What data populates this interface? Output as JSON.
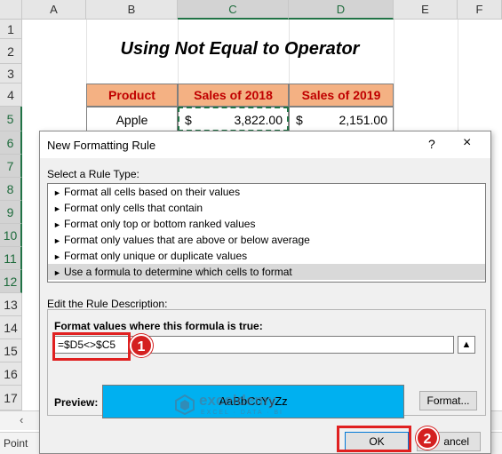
{
  "sheet": {
    "columns": [
      "A",
      "B",
      "C",
      "D",
      "E",
      "F"
    ],
    "rows": [
      "1",
      "2",
      "3",
      "4",
      "5",
      "6",
      "7",
      "8",
      "9",
      "10",
      "11",
      "12",
      "13",
      "14",
      "15",
      "16",
      "17"
    ],
    "title": "Using Not Equal to Operator",
    "headers": [
      "Product",
      "Sales of 2018",
      "Sales of 2019"
    ],
    "row5": {
      "product": "Apple",
      "cur1": "$",
      "sales2018": "3,822.00",
      "cur2": "$",
      "sales2019": "2,151.00"
    },
    "status": "Point",
    "colors": {
      "header_fill": "#f4b183",
      "header_text": "#c00000",
      "selection": "#217346"
    }
  },
  "dialog": {
    "title": "New Formatting Rule",
    "help": "?",
    "close": "×",
    "select_rule_label": "Select a Rule Type:",
    "rule_types": [
      "Format all cells based on their values",
      "Format only cells that contain",
      "Format only top or bottom ranked values",
      "Format only values that are above or below average",
      "Format only unique or duplicate values",
      "Use a formula to determine which cells to format"
    ],
    "selected_rule_index": 5,
    "edit_label": "Edit the Rule Description:",
    "format_values_label": "Format values where this formula is true:",
    "formula": "=$D5<>$C5",
    "preview_label": "Preview:",
    "preview_text": "AaBbCcYyZz",
    "preview_color": "#00b0f0",
    "format_button": "Format...",
    "ok_button": "OK",
    "cancel_button": "ancel"
  },
  "callouts": {
    "badge1": "1",
    "badge2": "2"
  },
  "watermark": {
    "name": "exceldemy",
    "tagline": "EXCEL · DATA · BI"
  }
}
